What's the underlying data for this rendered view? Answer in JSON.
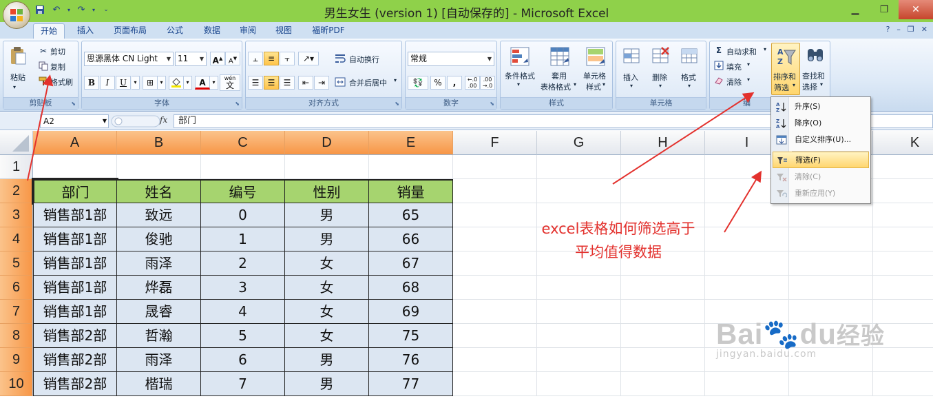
{
  "window": {
    "title": "男生女生 (version 1) [自动保存的] - Microsoft Excel"
  },
  "tabs": [
    "开始",
    "插入",
    "页面布局",
    "公式",
    "数据",
    "审阅",
    "视图",
    "福昕PDF"
  ],
  "ribbon": {
    "clipboard": {
      "label": "剪贴板",
      "paste": "粘贴",
      "cut": "剪切",
      "copy": "复制",
      "format_painter": "格式刷"
    },
    "font": {
      "label": "字体",
      "font_name": "思源黑体 CN Light",
      "font_size": "11",
      "bold": "B",
      "italic": "I",
      "underline": "U",
      "font_color": "A",
      "wen": "wén",
      "wen_char": "文"
    },
    "alignment": {
      "label": "对齐方式",
      "wrap": "自动换行",
      "merge": "合并后居中"
    },
    "number": {
      "label": "数字",
      "format": "常规",
      "percent": "%",
      "comma": ",",
      "inc_dec": ".00",
      "dec_dec": ".00"
    },
    "styles": {
      "label": "样式",
      "conditional": "条件格式",
      "table_format_1": "套用",
      "table_format_2": "表格格式",
      "cell_styles_1": "单元格",
      "cell_styles_2": "样式"
    },
    "cells": {
      "label": "单元格",
      "insert": "插入",
      "delete": "删除",
      "format": "格式"
    },
    "editing": {
      "label": "编",
      "autosum": "自动求和",
      "fill": "填充",
      "clear": "清除",
      "sort_filter_1": "排序和",
      "sort_filter_2": "筛选",
      "find_1": "查找和",
      "find_2": "选择"
    }
  },
  "formula_bar": {
    "name_box": "A2",
    "fx": "fx",
    "value": "部门"
  },
  "columns": [
    "A",
    "B",
    "C",
    "D",
    "E",
    "F",
    "G",
    "H",
    "I",
    "K"
  ],
  "rows": [
    "1",
    "2",
    "3",
    "4",
    "5",
    "6",
    "7",
    "8",
    "9",
    "10"
  ],
  "table": {
    "headers": [
      "部门",
      "姓名",
      "编号",
      "性别",
      "销量"
    ],
    "rows": [
      [
        "销售部1部",
        "致远",
        "0",
        "男",
        "65"
      ],
      [
        "销售部1部",
        "俊驰",
        "1",
        "男",
        "66"
      ],
      [
        "销售部1部",
        "雨泽",
        "2",
        "女",
        "67"
      ],
      [
        "销售部1部",
        "烨磊",
        "3",
        "女",
        "68"
      ],
      [
        "销售部1部",
        "晟睿",
        "4",
        "女",
        "69"
      ],
      [
        "销售部2部",
        "哲瀚",
        "5",
        "女",
        "75"
      ],
      [
        "销售部2部",
        "雨泽",
        "6",
        "男",
        "76"
      ],
      [
        "销售部2部",
        "楷瑞",
        "7",
        "男",
        "77"
      ]
    ]
  },
  "menu": {
    "items": [
      {
        "label": "升序(S)",
        "icon": "sort-asc-icon"
      },
      {
        "label": "降序(O)",
        "icon": "sort-desc-icon"
      },
      {
        "label": "自定义排序(U)...",
        "icon": "custom-sort-icon"
      },
      {
        "label": "筛选(F)",
        "icon": "filter-icon"
      },
      {
        "label": "清除(C)",
        "icon": "clear-filter-icon"
      },
      {
        "label": "重新应用(Y)",
        "icon": "reapply-icon"
      }
    ]
  },
  "annotation": {
    "line1": "excel表格如何筛选高于",
    "line2": "平均值得数据"
  },
  "watermark": {
    "brand": "Bai",
    "brand2": "du",
    "brand_cn": "经验",
    "url": "jingyan.baidu.com"
  },
  "colors": {
    "title_bar": "#8fd14a",
    "selected_header": "#f79646",
    "table_header": "#a6d46f",
    "table_body": "#dce6f2",
    "annotation": "#e3312d"
  }
}
